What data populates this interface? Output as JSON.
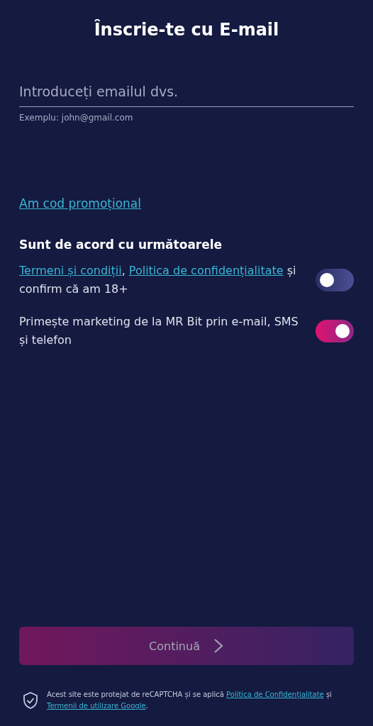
{
  "title": "Înscrie-te cu E-mail",
  "email_field": {
    "placeholder": "Introduceți emailul dvs.",
    "hint": "Exemplu: john@gmail.com"
  },
  "promo_link": "Am cod promoțional",
  "consents": {
    "heading": "Sunt de acord cu următoarele",
    "items": [
      {
        "on": false,
        "segments": [
          {
            "kind": "link",
            "text": "Termeni și condiții"
          },
          {
            "kind": "text",
            "text": ", "
          },
          {
            "kind": "link",
            "text": "Politica de confidențialitate"
          },
          {
            "kind": "text",
            "text": " și confirm că am 18+"
          }
        ]
      },
      {
        "on": true,
        "segments": [
          {
            "kind": "text",
            "text": "Primește marketing de la MR Bit prin e-mail, SMS și telefon"
          }
        ]
      }
    ]
  },
  "continue_button": {
    "label": "Continuă",
    "disabled": true
  },
  "recaptcha_notice": {
    "segments": [
      {
        "kind": "text",
        "text": "Acest site este protejat de reCAPTCHA și se aplică "
      },
      {
        "kind": "link",
        "text": "Politica de Confidențialitate"
      },
      {
        "kind": "text",
        "text": " și "
      },
      {
        "kind": "link",
        "text": "Termenii de utilizare Google"
      },
      {
        "kind": "text",
        "text": "."
      }
    ]
  }
}
